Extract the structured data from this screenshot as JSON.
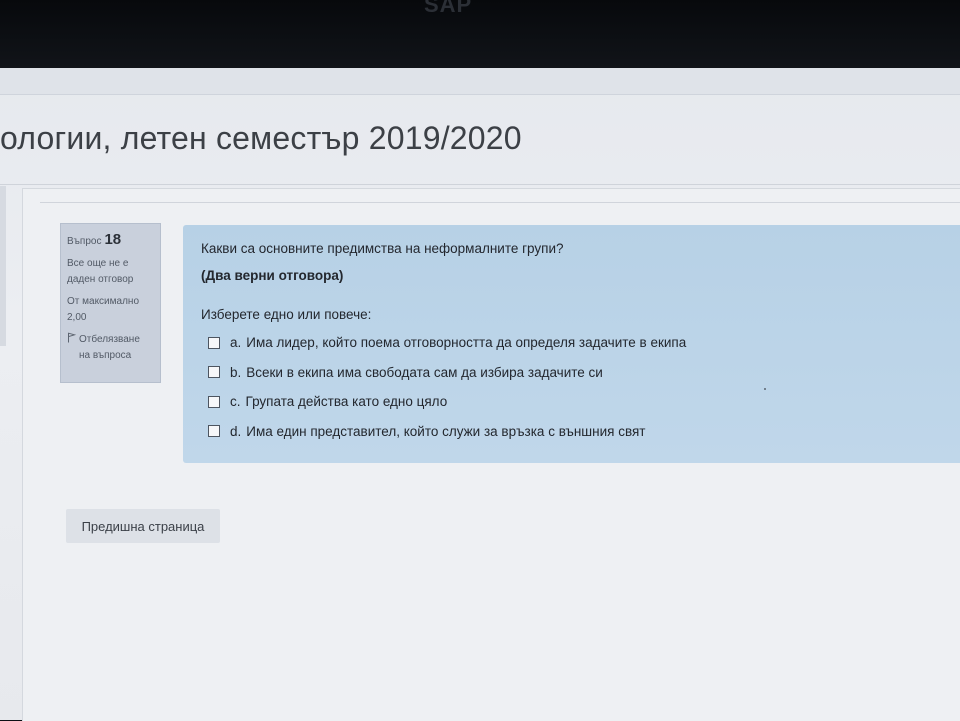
{
  "bezel": {
    "brand": "SAP"
  },
  "page": {
    "heading": "ологии, летен семестър 2019/2020"
  },
  "info": {
    "question_label": "Въпрос",
    "question_number": "18",
    "status_line1": "Все още не е",
    "status_line2": "даден отговор",
    "max_line1": "От максимално",
    "max_line2": "2,00",
    "flag_line1": "Отбелязване",
    "flag_line2": "на въпроса"
  },
  "question": {
    "text": "Какви са основните предимства на неформалните групи?",
    "hint": "(Два верни отговора)",
    "prompt": "Изберете едно или повече:",
    "options": [
      {
        "letter": "a.",
        "text": "Има лидер, който поема отговорността да определя задачите в екипа",
        "checked": false
      },
      {
        "letter": "b.",
        "text": "Всеки в екипа има свободата сам да избира задачите си",
        "checked": false
      },
      {
        "letter": "c.",
        "text": "Групата действа като едно цяло",
        "checked": false
      },
      {
        "letter": "d.",
        "text": "Има един представител, който служи за връзка с външния свят",
        "checked": false
      }
    ]
  },
  "nav": {
    "prev_label": "Предишна страница"
  },
  "icons": {
    "flag": "flag-icon"
  },
  "colors": {
    "question_bg": "#b7d1e6",
    "info_bg": "#c9d0dc",
    "button_bg": "#dde1e7"
  }
}
